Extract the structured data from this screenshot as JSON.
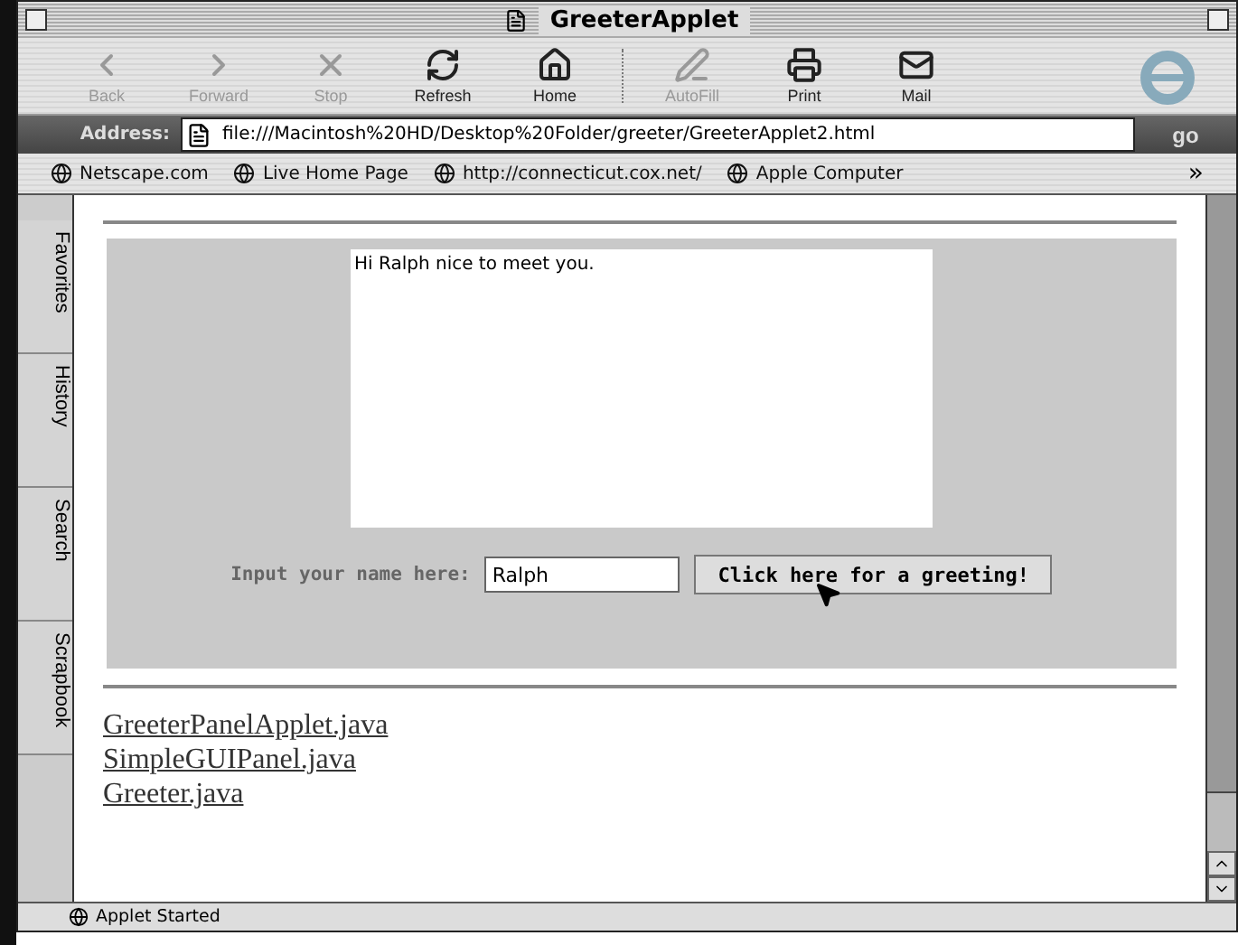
{
  "window": {
    "title": "GreeterApplet"
  },
  "toolbar": [
    {
      "label": "Back",
      "kind": "back",
      "disabled": true
    },
    {
      "label": "Forward",
      "kind": "forward",
      "disabled": true
    },
    {
      "label": "Stop",
      "kind": "stop",
      "disabled": true
    },
    {
      "label": "Refresh",
      "kind": "refresh",
      "disabled": false
    },
    {
      "label": "Home",
      "kind": "home",
      "disabled": false
    },
    {
      "label": "AutoFill",
      "kind": "autofill",
      "disabled": true
    },
    {
      "label": "Print",
      "kind": "print",
      "disabled": false
    },
    {
      "label": "Mail",
      "kind": "mail",
      "disabled": false
    }
  ],
  "address": {
    "label": "Address:",
    "value": "file:///Macintosh%20HD/Desktop%20Folder/greeter/GreeterApplet2.html",
    "go": "go"
  },
  "favorites_bar": {
    "items": [
      "Netscape.com",
      "Live Home Page",
      "http://connecticut.cox.net/",
      "Apple Computer"
    ],
    "more": "»"
  },
  "side_tabs": [
    "Favorites",
    "History",
    "Search",
    "Scrapbook"
  ],
  "applet": {
    "output": "Hi Ralph nice to meet you.",
    "input_label": "Input your name here:",
    "input_value": "Ralph",
    "button": "Click here for a greeting!"
  },
  "links": [
    "GreeterPanelApplet.java",
    "SimpleGUIPanel.java",
    "Greeter.java"
  ],
  "status_bar": {
    "text": "Applet Started"
  }
}
